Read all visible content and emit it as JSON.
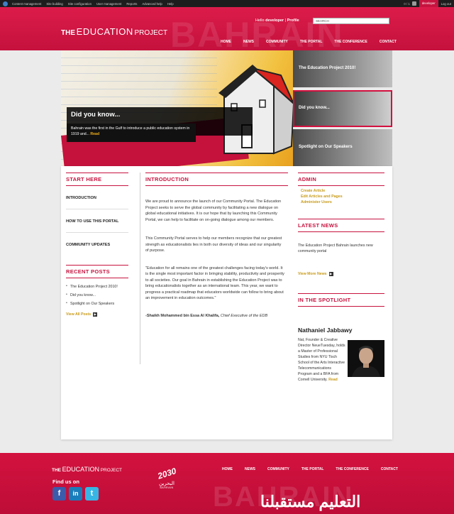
{
  "admin_bar": {
    "items": [
      "Content management",
      "Site building",
      "Site configuration",
      "User management",
      "Reports",
      "Advanced help",
      "Help"
    ],
    "count": "0 / 1",
    "user": "developer",
    "logout": "Log out"
  },
  "header": {
    "logo": {
      "the": "THE",
      "education": "EDUCATION",
      "project": "PROJECT"
    },
    "bg_word": "BAHRAIN",
    "hello_prefix": "Hello",
    "hello_user": "developer",
    "profile": "Profile",
    "search_placeholder": "SEARCH",
    "nav": [
      "HOME",
      "NEWS",
      "COMMUNITY",
      "THE PORTAL",
      "THE CONFERENCE",
      "CONTACT"
    ]
  },
  "hero": {
    "title": "Did you know...",
    "caption": "Bahrain was the first in the Gulf to introduce a public education system in 1919 and...",
    "read": "Read",
    "tabs": [
      "The Education Project 2010!",
      "Did you know...",
      "Spotlight on Our Speakers"
    ],
    "active_tab": 1
  },
  "left": {
    "start_title": "START HERE",
    "start_items": [
      "INTRODUCTION",
      "HOW TO USE THIS PORTAL",
      "COMMUNITY UPDATES"
    ],
    "recent_title": "RECENT POSTS",
    "recent_items": [
      "The Education Project 2010!",
      "Did you know...",
      "Spotlight on Our Speakers"
    ],
    "view_all": "View All Posts"
  },
  "center": {
    "title": "INTRODUCTION",
    "p1": "We are proud to announce the launch of our Community Portal. The Education Project seeks to serve the global community by facilitating a new dialogue on global educational initiatives. It is our hope that by launching this Community Portal, we can help to facilitate on on-going dialogue among our members.",
    "p2": "This Community Portal serves to help our members recognize that our greatest strength as educationalists lies in both our diversity of ideas and our singularity of purpose.",
    "p3": "\"Education for all remains one of the greatest challenges facing today's world. It is the single most important factor in bringing stability, productivity and prosperity to all societies. Our goal in Bahrain in establishing the Education Project was to bring educationalists together as an international team. This year, we want to progress a practical roadmap that educators worldwide can follow to bring about an improvement in education outcomes.\"",
    "attrib_name": "-Shaikh Mohammed bin Essa Al Khalifa,",
    "attrib_role": "Chief Executive of the EDB"
  },
  "right": {
    "admin_title": "ADMIN",
    "admin_links": [
      "Create Article",
      "Edit Articles and Pages",
      "Administer Users"
    ],
    "news_title": "LATEST NEWS",
    "news_text": "The Education Project Bahrain launches new community portal",
    "view_more": "View More News",
    "spotlight_title": "IN THE SPOTLIGHT",
    "spotlight_name": "Nathaniel Jabbawy",
    "spotlight_bio": "Nat, Founder & Creative Director NeueTuesday, holds a Master of Professional Studies from NYU Tisch School of the Arts Interactive Telecommunications Program and a BFA from Cornell University.",
    "spotlight_read": "Read"
  },
  "footer": {
    "logo": {
      "the": "THE",
      "education": "EDUCATION",
      "project": "PROJECT"
    },
    "find_us": "Find us on",
    "social": [
      "f",
      "in",
      "t"
    ],
    "emblem_year": "2030",
    "emblem_arabic": "البحرين",
    "emblem_sub": "BAHRAIN",
    "nav": [
      "HOME",
      "NEWS",
      "COMMUNITY",
      "THE PORTAL",
      "THE CONFERENCE",
      "CONTACT"
    ],
    "bg_word": "BAHRAIN",
    "arabic_slogan": "التعليم مستقبلنا"
  },
  "colors": {
    "brand": "#c7133f",
    "gold": "#c89b1a"
  }
}
